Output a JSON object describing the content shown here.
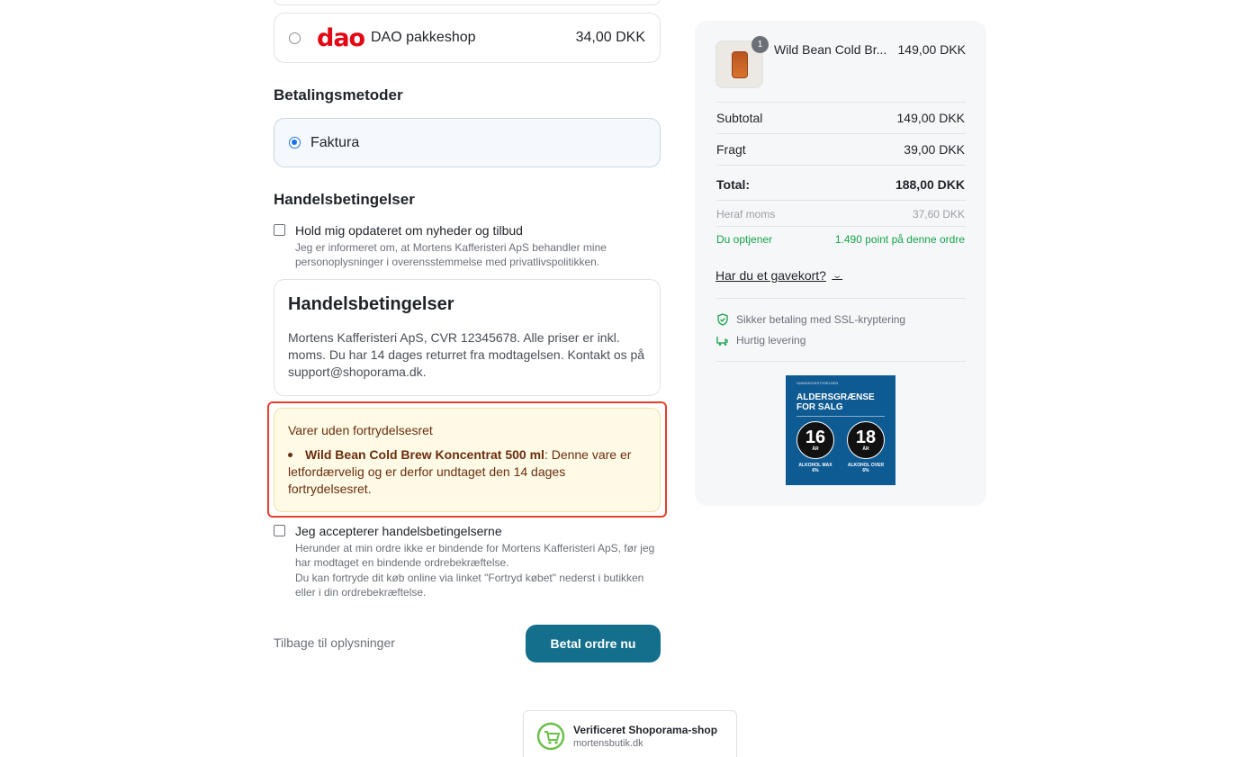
{
  "shipping": {
    "option": {
      "name": "DAO pakkeshop",
      "price": "34,00 DKK",
      "logo_text": "dao"
    }
  },
  "payment": {
    "heading": "Betalingsmetoder",
    "method": "Faktura"
  },
  "terms_section": {
    "heading": "Handelsbetingelser",
    "newsletter": {
      "label": "Hold mig opdateret om nyheder og tilbud",
      "sub": "Jeg er informeret om, at Mortens Kafferisteri ApS behandler mine personoplysninger i overensstemmelse med privatlivspolitikken."
    },
    "terms_box": {
      "title": "Handelsbetingelser",
      "body": "Mortens Kafferisteri ApS, CVR 12345678. Alle priser er inkl. moms. Du har 14 dages returret fra modtagelsen. Kontakt os på support@shoporama.dk."
    },
    "warning": {
      "title": "Varer uden fortrydelsesret",
      "item_name": "Wild Bean Cold Brew Koncentrat 500 ml",
      "item_text": ": Denne vare er letfordærvelig og er derfor undtaget den 14 dages fortrydelsesret."
    },
    "accept": {
      "label": "Jeg accepterer handelsbetingelserne",
      "sub1": "Herunder at min ordre ikke er bindende for Mortens Kafferisteri ApS, før jeg har modtaget en bindende ordrebekræftelse.",
      "sub2": "Du kan fortryde dit køb online via linket \"Fortryd købet\" nederst i butikken eller i din ordrebekræftelse."
    }
  },
  "actions": {
    "back": "Tilbage til oplysninger",
    "pay": "Betal ordre nu"
  },
  "verified": {
    "title": "Verificeret Shoporama-shop",
    "domain": "mortensbutik.dk"
  },
  "summary": {
    "product": {
      "name": "Wild Bean Cold Br...",
      "price": "149,00 DKK",
      "qty": "1"
    },
    "subtotal": {
      "label": "Subtotal",
      "value": "149,00 DKK"
    },
    "shipping": {
      "label": "Fragt",
      "value": "39,00 DKK"
    },
    "total": {
      "label": "Total:",
      "value": "188,00 DKK"
    },
    "vat": {
      "label": "Heraf moms",
      "value": "37,60 DKK"
    },
    "points": {
      "label": "Du optjener",
      "value": "1.490 point på denne ordre"
    },
    "giftcard": "Har du et gavekort?",
    "features": [
      "Sikker betaling med SSL-kryptering",
      "Hurtig levering"
    ],
    "age_sign": {
      "top": "SUNDHEDSSTYRELSEN",
      "title": "ALDERSGRÆNSE FOR SALG",
      "left": {
        "num": "16",
        "unit": "ÅR",
        "caption": "ALKOHOL MAX 6%"
      },
      "right": {
        "num": "18",
        "unit": "ÅR",
        "caption": "ALKOHOL OVER 6%"
      }
    }
  },
  "colors": {
    "primary_button": "#136f8c",
    "warning_border": "#e5402b",
    "warning_bg": "#fefae6",
    "points_green": "#16a34a",
    "dao_red": "#e30613"
  }
}
